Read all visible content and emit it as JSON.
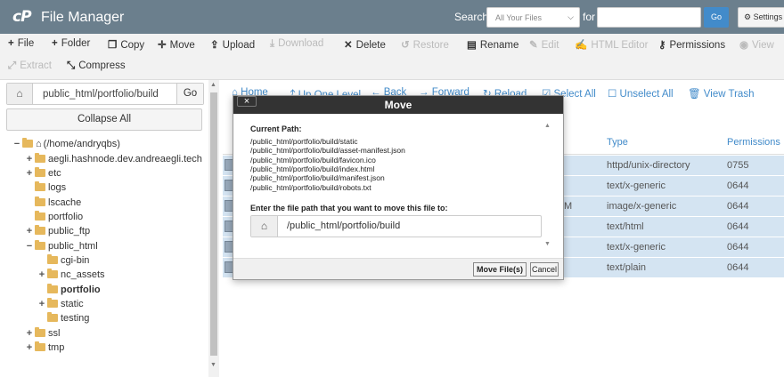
{
  "header": {
    "logo": "cP",
    "title": "File Manager",
    "search_label": "Search",
    "search_scope": "All Your Files",
    "for_label": "for",
    "search_value": "",
    "go_label": "Go",
    "settings_label": "Settings"
  },
  "toolbar": {
    "file": "File",
    "folder": "Folder",
    "copy": "Copy",
    "move": "Move",
    "upload": "Upload",
    "download": "Download",
    "delete": "Delete",
    "restore": "Restore",
    "rename": "Rename",
    "edit": "Edit",
    "html_editor": "HTML Editor",
    "permissions": "Permissions",
    "view": "View",
    "extract": "Extract",
    "compress": "Compress"
  },
  "sidebar": {
    "path": "public_html/portfolio/build",
    "go_label": "Go",
    "collapse_label": "Collapse All",
    "tree": [
      {
        "label": "(/home/andryqbs)",
        "toggle": "−",
        "home": true
      },
      {
        "label": "aegli.hashnode.dev.andreaegli.tech",
        "toggle": "+"
      },
      {
        "label": "etc",
        "toggle": "+"
      },
      {
        "label": "logs",
        "toggle": ""
      },
      {
        "label": "lscache",
        "toggle": ""
      },
      {
        "label": "portfolio",
        "toggle": ""
      },
      {
        "label": "public_ftp",
        "toggle": "+"
      },
      {
        "label": "public_html",
        "toggle": "−"
      },
      {
        "label": "cgi-bin",
        "toggle": ""
      },
      {
        "label": "nc_assets",
        "toggle": "+"
      },
      {
        "label": "portfolio",
        "toggle": ""
      },
      {
        "label": "static",
        "toggle": "+"
      },
      {
        "label": "testing",
        "toggle": ""
      },
      {
        "label": "ssl",
        "toggle": "+"
      },
      {
        "label": "tmp",
        "toggle": "+"
      }
    ]
  },
  "main_toolbar": {
    "home": "Home",
    "up_one_level": "Up One Level",
    "back": "Back",
    "forward": "Forward",
    "reload": "Reload",
    "select_all": "Select All",
    "unselect_all": "Unselect All",
    "view_trash": "View Trash"
  },
  "table": {
    "headers": {
      "type": "Type",
      "permissions": "Permissions"
    },
    "rows": [
      {
        "modified": "",
        "type": "httpd/unix-directory",
        "permissions": "0755"
      },
      {
        "modified": "",
        "type": "text/x-generic",
        "permissions": "0644"
      },
      {
        "modified": "M",
        "type": "image/x-generic",
        "permissions": "0644"
      },
      {
        "modified": "",
        "type": "text/html",
        "permissions": "0644"
      },
      {
        "modified": "",
        "type": "text/x-generic",
        "permissions": "0644"
      },
      {
        "modified": "",
        "type": "text/plain",
        "permissions": "0644"
      }
    ]
  },
  "modal": {
    "title": "Move",
    "close_label": "×",
    "current_path_label": "Current Path:",
    "current_paths": [
      "/public_html/portfolio/build/static",
      "/public_html/portfolio/build/asset-manifest.json",
      "/public_html/portfolio/build/favicon.ico",
      "/public_html/portfolio/build/index.html",
      "/public_html/portfolio/build/manifest.json",
      "/public_html/portfolio/build/robots.txt"
    ],
    "destination_label": "Enter the file path that you want to move this file to:",
    "destination_value": "/public_html/portfolio/build",
    "move_button": "Move File(s)",
    "cancel_button": "Cancel"
  },
  "colors": {
    "topbar": "#6b7f8d",
    "accent": "#428bca",
    "selected_row": "#d4e4f2",
    "modal_header": "#333333",
    "folder": "#e6b85c"
  }
}
